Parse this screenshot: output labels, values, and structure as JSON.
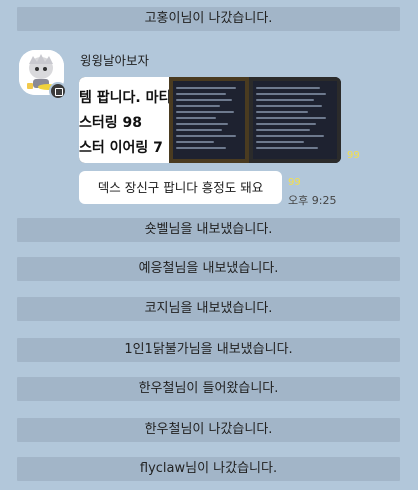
{
  "messages": {
    "top_system": "고홍이님이 나갔습니다.",
    "sender_name": "윙윙날아보자",
    "image_text_lines": [
      "템 팝니다. 마티",
      "스터링 98",
      "스터 이어링 7"
    ],
    "image_read_count": "99",
    "bubble_text": "덱스 장신구 팝니다 흥정도 돼요",
    "bubble_read_count": "99",
    "bubble_time": "오후 9:25",
    "system_list": [
      "숏벨님을 내보냈습니다.",
      "예응철님을 내보냈습니다.",
      "코지님을 내보냈습니다.",
      "1인1닭불가님을 내보냈습니다.",
      "한우철님이 들어왔습니다.",
      "한우철님이 나갔습니다.",
      "flyclaw님이 나갔습니다."
    ]
  },
  "colors": {
    "background": "#b2c7da",
    "system_bar": "#a2b5c8",
    "read_count": "#f5e04a",
    "bubble": "#ffffff"
  }
}
